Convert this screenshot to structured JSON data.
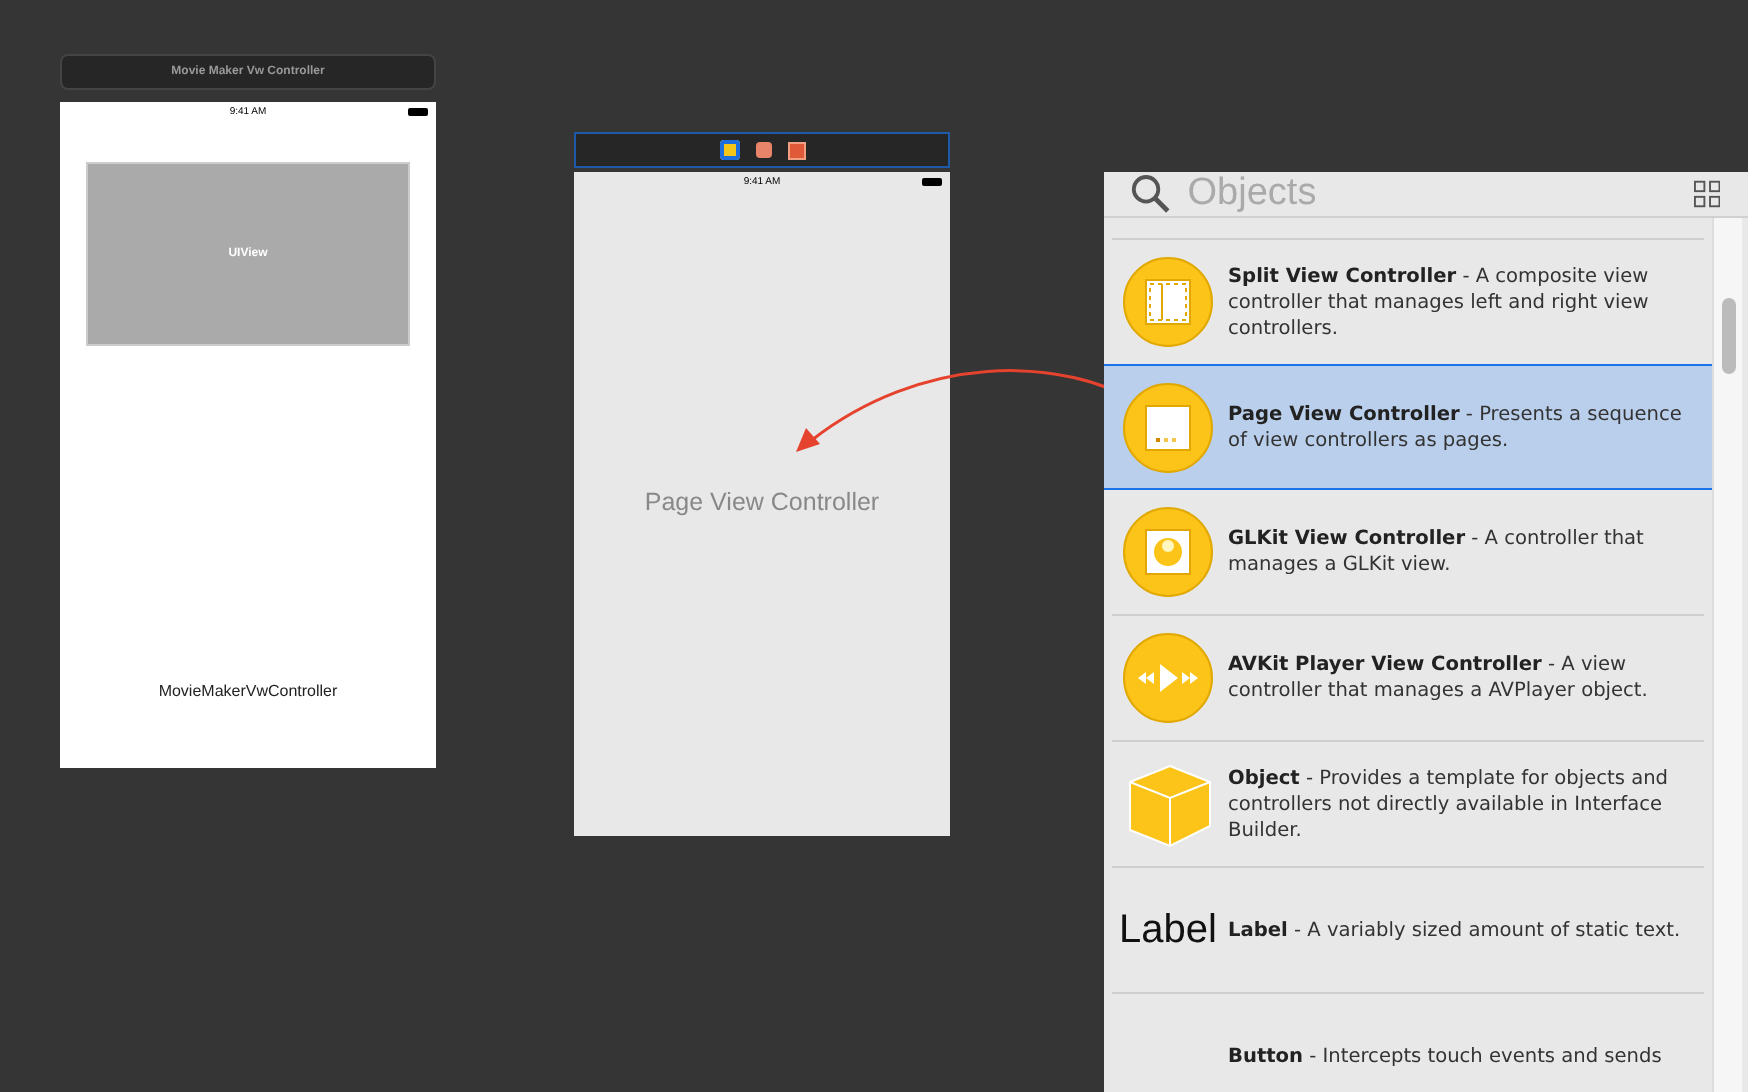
{
  "scene_one": {
    "title": "Movie Maker Vw Controller",
    "status_time": "9:41 AM",
    "view_label": "UIView",
    "controller_label": "MovieMakerVwController"
  },
  "scene_two": {
    "status_time": "9:41 AM",
    "placeholder_label": "Page View Controller",
    "arrow": true
  },
  "library": {
    "search": {
      "placeholder": "Objects"
    },
    "items": [
      {
        "kind": "split",
        "name": "Split View Controller",
        "description": " - A composite view controller that manages left and right view controllers.",
        "selected": false
      },
      {
        "kind": "page",
        "name": "Page View Controller",
        "description": " - Presents a sequence of view controllers as pages.",
        "selected": true
      },
      {
        "kind": "glkit",
        "name": "GLKit View Controller",
        "description": " - A controller that manages a GLKit view.",
        "selected": false
      },
      {
        "kind": "avkit",
        "name": "AVKit Player View Controller",
        "description": " - A view controller that manages a AVPlayer object.",
        "selected": false
      },
      {
        "kind": "object",
        "name": "Object",
        "description": " - Provides a template for objects and controllers not directly available in Interface Builder.",
        "selected": false
      },
      {
        "kind": "label",
        "name": "Label",
        "description": " - A variably sized amount of static text.",
        "selected": false,
        "icon_text": "Label"
      },
      {
        "kind": "button",
        "name": "Button",
        "description": " - Intercepts touch events and sends",
        "selected": false
      }
    ]
  }
}
